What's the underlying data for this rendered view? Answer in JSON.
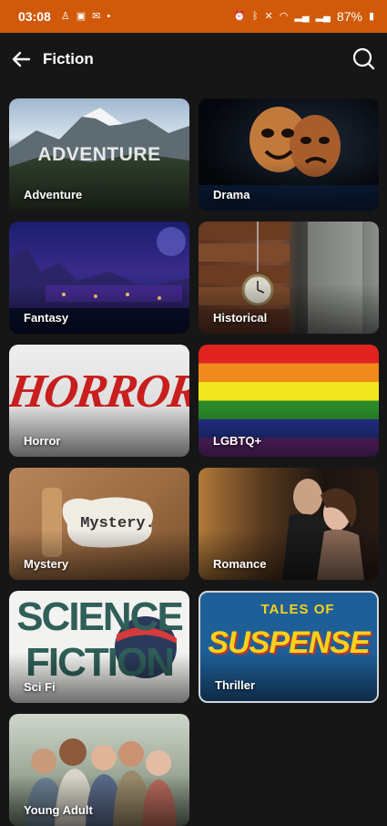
{
  "status_bar": {
    "time": "03:08",
    "battery": "87%"
  },
  "header": {
    "title": "Fiction"
  },
  "tiles": [
    {
      "label": "Adventure",
      "art_text": "ADVENTURE"
    },
    {
      "label": "Drama"
    },
    {
      "label": "Fantasy"
    },
    {
      "label": "Historical"
    },
    {
      "label": "Horror",
      "art_text": "HORROR"
    },
    {
      "label": "LGBTQ+"
    },
    {
      "label": "Mystery",
      "art_text": "Mystery."
    },
    {
      "label": "Romance"
    },
    {
      "label": "Sci Fi",
      "art_text_1": "SCIENCE",
      "art_text_2": "FICTION"
    },
    {
      "label": "Thriller",
      "art_text_1": "TALES OF",
      "art_text_2": "SUSPENSE"
    },
    {
      "label": "Young Adult"
    }
  ],
  "colors": {
    "status_bar": "#d05a0a",
    "background": "#161616"
  }
}
